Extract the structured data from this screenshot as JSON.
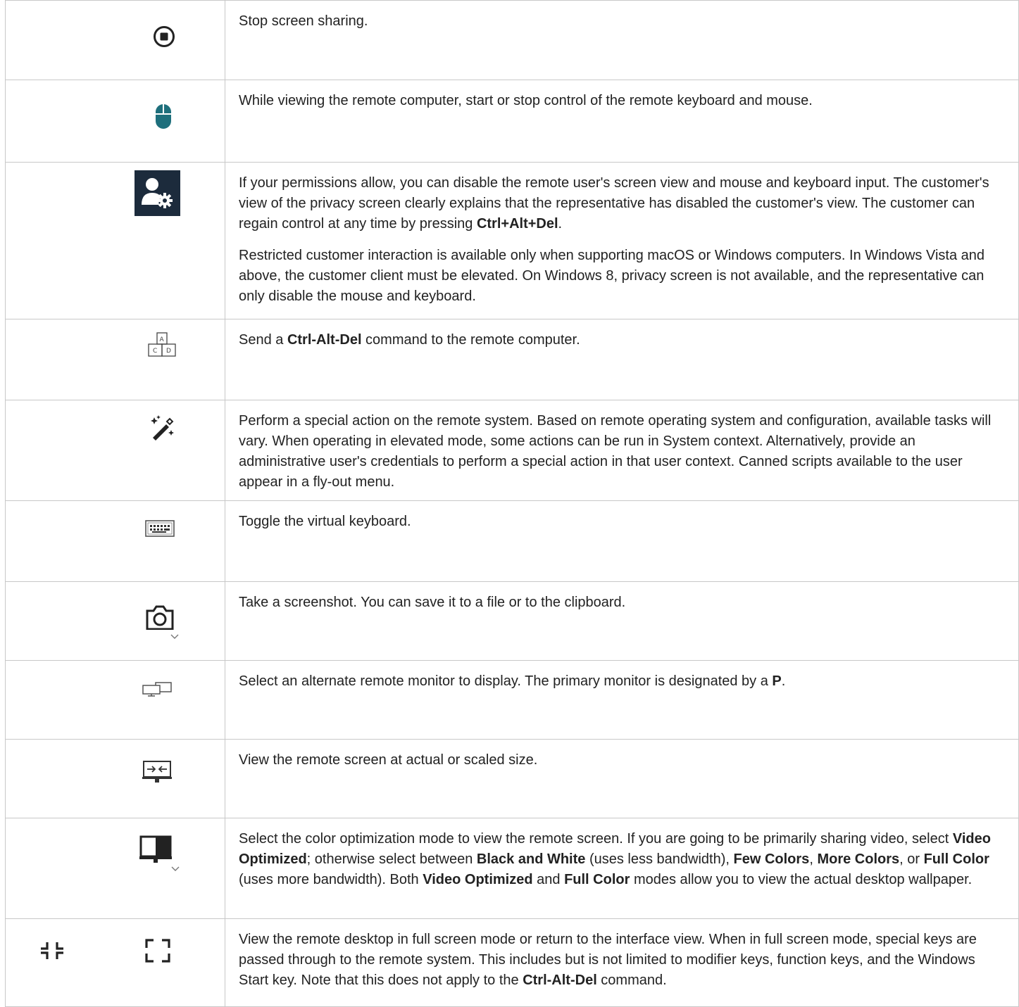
{
  "rows": [
    {
      "icon": "stop-share-icon",
      "paragraphs": [
        [
          {
            "t": "Stop screen sharing."
          }
        ]
      ]
    },
    {
      "icon": "mouse-control-icon",
      "paragraphs": [
        [
          {
            "t": "While viewing the remote computer, start or stop control of the remote keyboard and mouse."
          }
        ]
      ]
    },
    {
      "icon": "privacy-screen-icon",
      "paragraphs": [
        [
          {
            "t": "If your permissions allow, you can disable the remote user's screen view and mouse and keyboard input. The customer's view of the privacy screen clearly explains that the representative has disabled the customer's view. The customer can regain control at any time by pressing "
          },
          {
            "t": "Ctrl+Alt+Del",
            "b": true
          },
          {
            "t": "."
          }
        ],
        [
          {
            "t": "Restricted customer interaction is available only when supporting macOS or Windows computers. In Windows Vista and above, the customer client must be elevated. On Windows 8, privacy screen is not available, and the representative can only disable the mouse and keyboard."
          }
        ]
      ]
    },
    {
      "icon": "ctrl-alt-del-icon",
      "paragraphs": [
        [
          {
            "t": "Send a "
          },
          {
            "t": "Ctrl-Alt-Del",
            "b": true
          },
          {
            "t": " command to the remote computer."
          }
        ]
      ]
    },
    {
      "icon": "magic-wand-icon",
      "paragraphs": [
        [
          {
            "t": "Perform a special action on the remote system. Based on remote operating system and configuration, available tasks will vary. When operating in elevated mode, some actions can be run in System context. Alternatively, provide an administrative user's credentials to perform a special action in that user context. Canned scripts available to the user appear in a fly-out menu."
          }
        ]
      ]
    },
    {
      "icon": "virtual-keyboard-icon",
      "paragraphs": [
        [
          {
            "t": "Toggle the virtual keyboard."
          }
        ]
      ]
    },
    {
      "icon": "camera-icon",
      "paragraphs": [
        [
          {
            "t": "Take a screenshot. You can save it to a file or to the clipboard."
          }
        ]
      ]
    },
    {
      "icon": "monitors-icon",
      "paragraphs": [
        [
          {
            "t": "Select an alternate remote monitor to display. The primary monitor is designated by a "
          },
          {
            "t": "P",
            "b": true
          },
          {
            "t": "."
          }
        ]
      ]
    },
    {
      "icon": "scale-screen-icon",
      "paragraphs": [
        [
          {
            "t": "View the remote screen at actual or scaled size."
          }
        ]
      ]
    },
    {
      "icon": "color-mode-icon",
      "paragraphs": [
        [
          {
            "t": "Select the color optimization mode to view the remote screen. If you are going to be primarily sharing video, select "
          },
          {
            "t": "Video Optimized",
            "b": true
          },
          {
            "t": "; otherwise select between "
          },
          {
            "t": "Black and White",
            "b": true
          },
          {
            "t": " (uses less bandwidth), "
          },
          {
            "t": "Few Colors",
            "b": true
          },
          {
            "t": ", "
          },
          {
            "t": "More Colors",
            "b": true
          },
          {
            "t": ", or "
          },
          {
            "t": "Full Color",
            "b": true
          },
          {
            "t": " (uses more bandwidth). Both "
          },
          {
            "t": "Video Optimized",
            "b": true
          },
          {
            "t": " and "
          },
          {
            "t": "Full Color",
            "b": true
          },
          {
            "t": " modes allow you to view the actual desktop wallpaper."
          }
        ]
      ]
    },
    {
      "icon": "fullscreen-icon",
      "paragraphs": [
        [
          {
            "t": "View the remote desktop in full screen mode or return to the interface view. When in full screen mode, special keys are passed through to the remote system. This includes but is not limited to modifier keys, function keys, and the Windows Start key. Note that this does not apply to the "
          },
          {
            "t": "Ctrl-Alt-Del",
            "b": true
          },
          {
            "t": " command."
          }
        ]
      ]
    }
  ],
  "colors": {
    "teal": "#1e6f7c",
    "dark": "#222222",
    "navy": "#1c2b3c",
    "border": "#c8c8c8"
  }
}
